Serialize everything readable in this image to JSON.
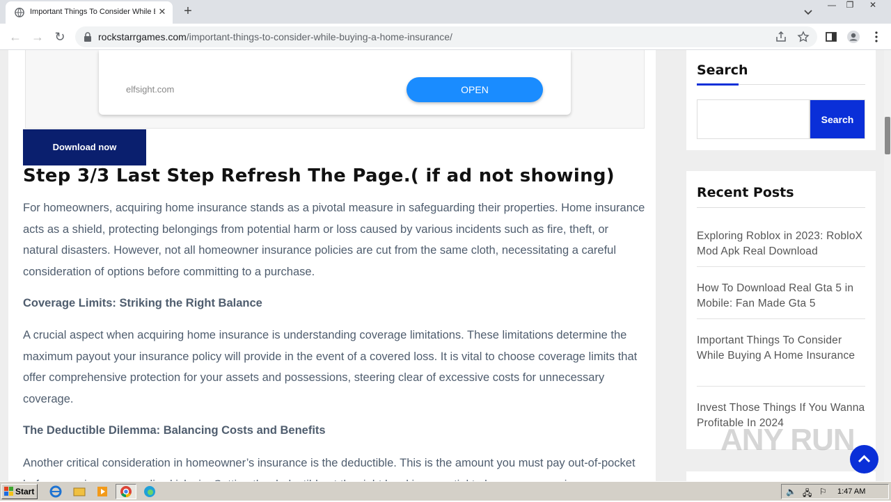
{
  "browser": {
    "tab_title": "Important Things To Consider While B",
    "new_tab_symbol": "+",
    "url_domain": "rockstarrgames.com",
    "url_path": "/important-things-to-consider-while-buying-a-home-insurance/",
    "window_controls": [
      "—",
      "❐",
      "✕"
    ]
  },
  "ad": {
    "brand": "elfsight.com",
    "open_label": "OPEN"
  },
  "article": {
    "download_label": "Download now",
    "step_title": "Step 3/3 Last Step Refresh The Page.( if ad not showing)",
    "intro": "For homeowners, acquiring home insurance stands as a pivotal measure in safeguarding their properties. Home insurance acts as a shield, protecting belongings from potential harm or loss caused by various incidents such as fire, theft, or natural disasters. However, not all homeowner insurance policies are cut from the same cloth, necessitating a careful consideration of options before committing to a purchase.",
    "h1": "Coverage Limits: Striking the Right Balance",
    "p1": "A crucial aspect when acquiring home insurance is understanding coverage limitations. These limitations determine the maximum payout your insurance policy will provide in the event of a covered loss. It is vital to choose coverage limits that offer comprehensive protection for your assets and possessions, steering clear of excessive costs for unnecessary coverage.",
    "h2": "The Deductible Dilemma: Balancing Costs and Benefits",
    "p2": "Another critical consideration in homeowner’s insurance is the deductible. This is the amount you must pay out-of-pocket before your insurance policy kicks in. Setting the deductible at the right level is essential to keep your premiums"
  },
  "sidebar": {
    "search_title": "Search",
    "search_button": "Search",
    "search_placeholder": "",
    "recent_title": "Recent Posts",
    "posts": [
      "Exploring Roblox in 2023: RobloX Mod Apk Real Download",
      "How To Download Real Gta 5 in Mobile: Fan Made Gta 5",
      "Important Things To Consider While Buying A Home Insurance",
      "Invest Those Things If You Wanna Profitable In 2024"
    ]
  },
  "watermark": "ANY RUN",
  "taskbar": {
    "start_label": "Start",
    "clock": "1:47 AM"
  },
  "colors": {
    "accent": "#0a2fd8",
    "download_bg": "#0a1f6e",
    "ad_button": "#1a8cff"
  }
}
